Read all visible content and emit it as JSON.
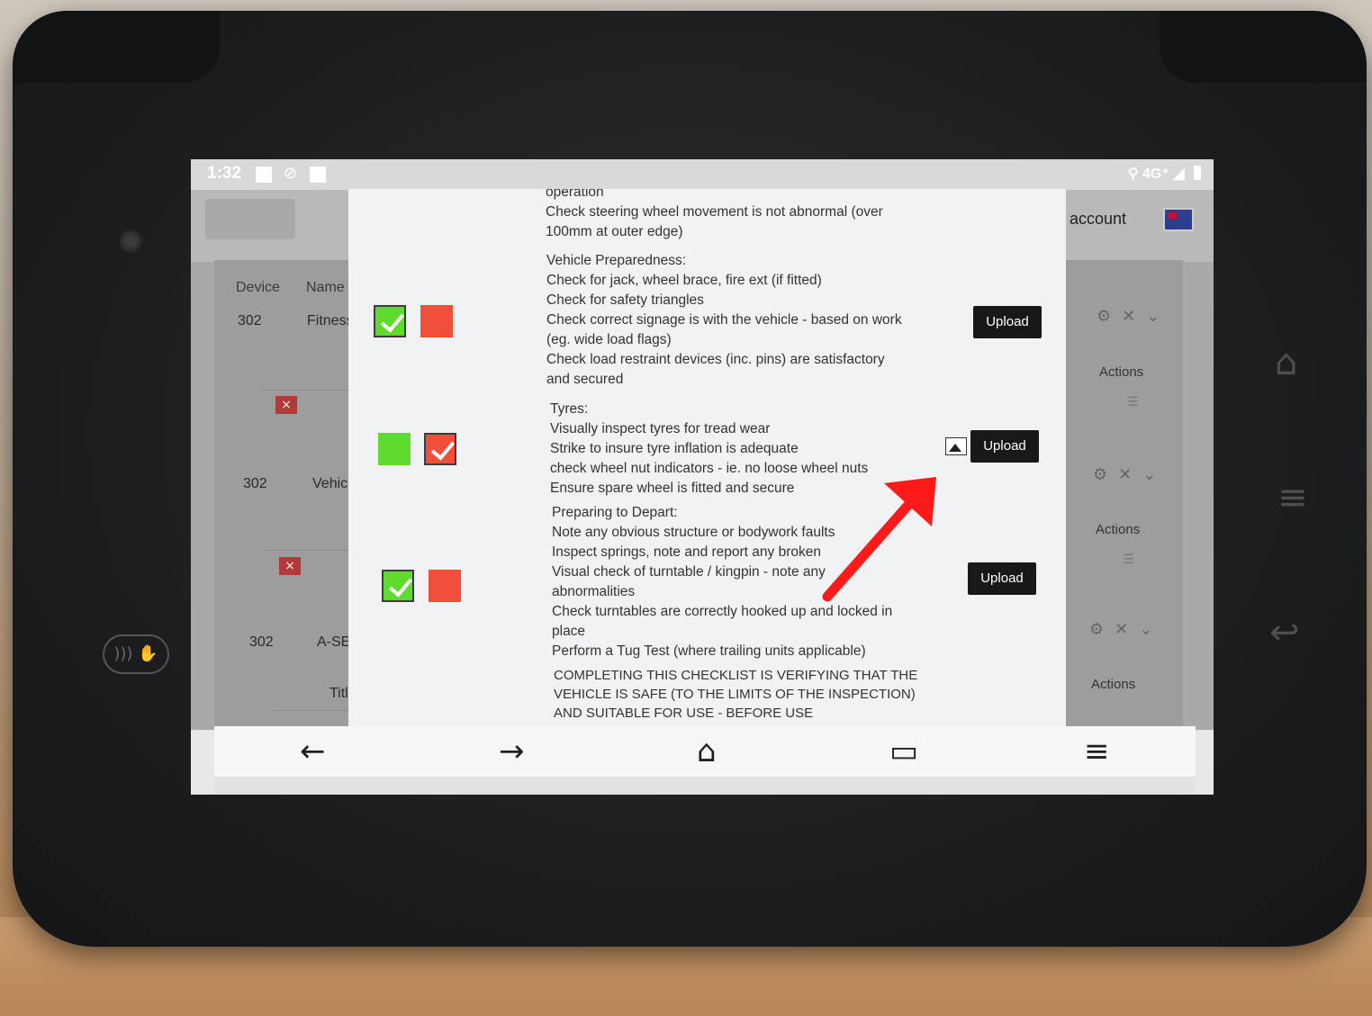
{
  "status": {
    "time": "1:32",
    "network": "4G⁺"
  },
  "background": {
    "account_label": "account",
    "columns": {
      "device": "Device",
      "name": "Name"
    },
    "rows": [
      {
        "device": "302",
        "name": "Fitness"
      },
      {
        "device": "302",
        "name": "Vehicl"
      },
      {
        "device": "302",
        "name": "A-SERV"
      }
    ],
    "title_label": "Title",
    "actions_label": "Actions",
    "remove_icon": "×"
  },
  "checklist": {
    "intro_lines": [
      "operation",
      "Check steering wheel movement is not abnormal (over",
      "100mm at outer edge)"
    ],
    "items": [
      {
        "selected": "ok",
        "lines": [
          "Vehicle Preparedness:",
          "Check for jack, wheel brace, fire ext (if fitted)",
          "Check for safety triangles",
          "Check correct signage is with the vehicle - based on work",
          "(eg. wide load flags)",
          "Check load restraint devices (inc. pins) are satisfactory",
          "and secured"
        ],
        "upload_label": "Upload",
        "has_image": false
      },
      {
        "selected": "fail",
        "lines": [
          "Tyres:",
          "Visually inspect tyres for tread wear",
          "Strike to insure tyre inflation is adequate",
          "check wheel nut indicators - ie. no loose wheel nuts",
          "Ensure spare wheel is fitted and secure"
        ],
        "upload_label": "Upload",
        "has_image": true
      },
      {
        "selected": "ok",
        "lines": [
          "Preparing to Depart:",
          "Note any obvious structure or bodywork faults",
          "Inspect springs, note and report any broken",
          "Visual check of turntable / kingpin - note any",
          "abnormalities",
          "Check turntables are correctly hooked up and locked in",
          "place",
          "Perform a Tug Test (where trailing units applicable)"
        ],
        "upload_label": "Upload",
        "has_image": false
      }
    ],
    "footer_lines": [
      "COMPLETING THIS CHECKLIST IS VERIFYING THAT THE",
      "VEHICLE IS SAFE (TO THE LIMITS OF THE INSPECTION)",
      "AND SUITABLE FOR USE - BEFORE USE"
    ]
  },
  "colors": {
    "ok": "#5fdb2d",
    "fail": "#f0503a",
    "annotation_arrow": "#ff1a1a"
  },
  "navbar": {
    "icons": [
      "back-arrow-icon",
      "forward-arrow-icon",
      "home-icon",
      "tabs-icon",
      "menu-icon"
    ]
  }
}
